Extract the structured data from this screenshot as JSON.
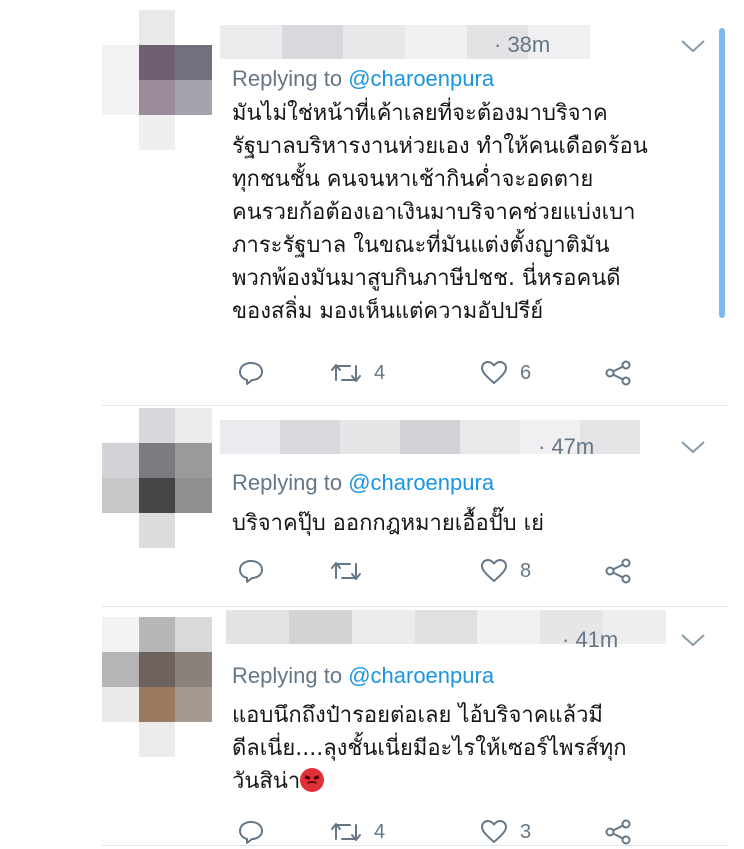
{
  "tweets": [
    {
      "time": "· 38m",
      "replying_prefix": "Replying to ",
      "replying_handle": "@charoenpura",
      "body_lines": [
        "มันไม่ใช่หน้าที่เค้าเลยที่จะต้องมาบริจาค",
        "รัฐบาลบริหารงานห่วยเอง ทำให้คนเดือดร้อน",
        "ทุกชนชั้น คนจนหาเช้ากินค่ำจะอดตาย",
        "คนรวยก้อต้องเอาเงินมาบริจาคช่วยแบ่งเบา",
        "ภาระรัฐบาล ในขณะที่มันแต่งตั้งญาติมัน",
        "พวกพ้องมันมาสูบกินภาษีปชช. นี่หรอคนดี",
        "ของสลิ่ม มองเห็นแต่ความอัปปรีย์"
      ],
      "retweets": "4",
      "likes": "6"
    },
    {
      "time": "· 47m",
      "replying_prefix": "Replying to ",
      "replying_handle": "@charoenpura",
      "body_lines": [
        "บริจาคปุ๊บ ออกกฎหมายเอื้อปั๊บ เย่"
      ],
      "retweets": "",
      "likes": "8"
    },
    {
      "time": "· 41m",
      "replying_prefix": "Replying to ",
      "replying_handle": "@charoenpura",
      "body_lines": [
        "แอบนึกถึงป๋ารอยต่อเลย ไอ้บริจาคแล้วมี",
        "ดีลเนี่ย....ลุงชั้นเนี่ยมีอะไรให้เซอร์ไพรส์ทุก",
        "วันสิน่า"
      ],
      "retweets": "4",
      "likes": "3"
    }
  ],
  "icons": {
    "reply": "reply-icon",
    "retweet": "retweet-icon",
    "like": "heart-icon",
    "share": "share-icon",
    "menu": "chevron-down-icon",
    "emoji": "angry-face-emoji"
  },
  "colors": {
    "text": "#14171a",
    "secondary": "#657786",
    "link": "#1b95e0",
    "divider": "#e1e8ed"
  }
}
